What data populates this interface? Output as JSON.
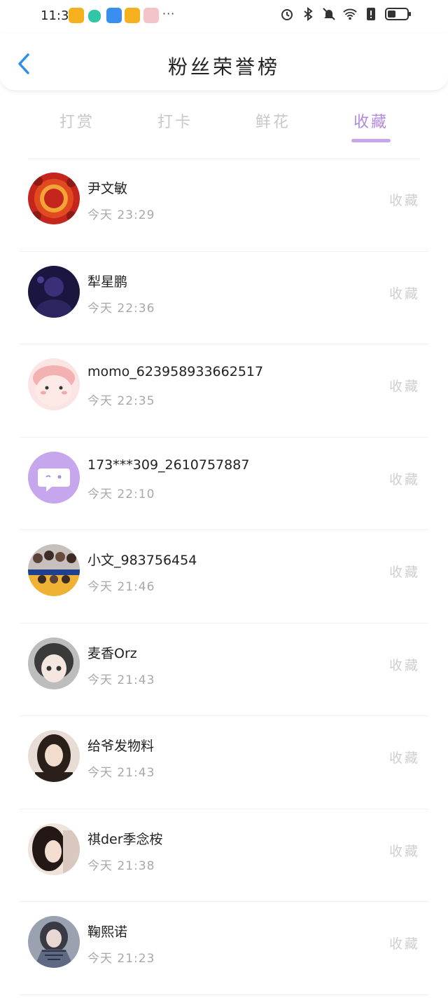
{
  "status_bar": {
    "time": "11:31",
    "more": "···",
    "app_icons": [
      "weibo-app-icon",
      "wechat-work-app-icon",
      "cloud-app-icon",
      "weibo-app-icon",
      "gift-box-app-icon"
    ],
    "system_icons": [
      "alarm-icon",
      "bluetooth-icon",
      "mute-bell-icon",
      "wifi-icon",
      "sim-alert-icon",
      "battery-icon"
    ]
  },
  "header": {
    "title": "粉丝荣誉榜",
    "back_icon": "chevron-left-icon"
  },
  "tabs": [
    {
      "label": "打赏",
      "active": false
    },
    {
      "label": "打卡",
      "active": false
    },
    {
      "label": "鲜花",
      "active": false
    },
    {
      "label": "收藏",
      "active": true
    }
  ],
  "colors": {
    "accent": "#b388e0",
    "accent_underline": "#c9a6ea",
    "back_icon": "#2f8ee8"
  },
  "fans": [
    {
      "name": "尹文敏",
      "time": "今天  23:29",
      "action": "收藏",
      "avatar": "red-fu-character-avatar"
    },
    {
      "name": "犁星鹏",
      "time": "今天  22:36",
      "action": "收藏",
      "avatar": "dark-purple-figure-avatar"
    },
    {
      "name": "momo_623958933662517",
      "time": "今天  22:35",
      "action": "收藏",
      "avatar": "pink-cartoon-avatar"
    },
    {
      "name": "173***309_2610757887",
      "time": "今天  22:10",
      "action": "收藏",
      "avatar": "purple-chat-bubble-avatar"
    },
    {
      "name": "小文_983756454",
      "time": "今天  21:46",
      "action": "收藏",
      "avatar": "group-photo-avatar"
    },
    {
      "name": "麦香Orz",
      "time": "今天  21:43",
      "action": "收藏",
      "avatar": "anime-girl-avatar"
    },
    {
      "name": "给爷发物料",
      "time": "今天  21:43",
      "action": "收藏",
      "avatar": "girl-portrait-avatar"
    },
    {
      "name": "祺der季念桉",
      "time": "今天  21:38",
      "action": "收藏",
      "avatar": "girl-selfie-avatar"
    },
    {
      "name": "鞠熙诺",
      "time": "今天  21:23",
      "action": "收藏",
      "avatar": "girl-scarf-avatar"
    }
  ]
}
